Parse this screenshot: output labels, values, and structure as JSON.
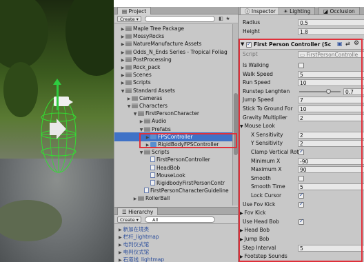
{
  "project": {
    "tab_label": "Project",
    "create_label": "Create",
    "search_placeholder": "",
    "items": [
      {
        "label": "Maple Tree Package",
        "kind": "folder",
        "expanded": false
      },
      {
        "label": "MossyRocks",
        "kind": "folder",
        "expanded": false
      },
      {
        "label": "NatureManufacture Assets",
        "kind": "folder",
        "expanded": false
      },
      {
        "label": "Odds_N_Ends Series - Tropical Foliag",
        "kind": "folder",
        "expanded": false
      },
      {
        "label": "PostProcessing",
        "kind": "folder",
        "expanded": false
      },
      {
        "label": "Rock_pack",
        "kind": "folder",
        "expanded": false
      },
      {
        "label": "Scenes",
        "kind": "folder",
        "expanded": false
      },
      {
        "label": "Scripts",
        "kind": "folder",
        "expanded": false
      },
      {
        "label": "Standard Assets",
        "kind": "folder",
        "expanded": true
      },
      {
        "label": "Cameras",
        "kind": "folder",
        "expanded": false
      },
      {
        "label": "Characters",
        "kind": "folder",
        "expanded": true
      },
      {
        "label": "FirstPersonCharacter",
        "kind": "folder",
        "expanded": true
      },
      {
        "label": "Audio",
        "kind": "folder",
        "expanded": false
      },
      {
        "label": "Prefabs",
        "kind": "folder",
        "expanded": true
      },
      {
        "label": "FPSController",
        "kind": "prefab",
        "expanded": false,
        "selected": true
      },
      {
        "label": "RigidBodyFPSController",
        "kind": "prefab",
        "expanded": false
      },
      {
        "label": "Scripts",
        "kind": "folder",
        "expanded": true
      },
      {
        "label": "FirstPersonController",
        "kind": "file"
      },
      {
        "label": "HeadBob",
        "kind": "file"
      },
      {
        "label": "MouseLook",
        "kind": "file"
      },
      {
        "label": "RigidbodyFirstPersonContr",
        "kind": "file"
      },
      {
        "label": "FirstPersonCharacterGuideline",
        "kind": "file"
      },
      {
        "label": "RollerBall",
        "kind": "folder",
        "expanded": false
      }
    ]
  },
  "hierarchy": {
    "tab_label": "Hierarchy",
    "create_label": "Create",
    "search_placeholder": "All",
    "items": [
      "新加在境类",
      "栏杆_lightmap",
      "电判仪式馆",
      "电判仪式馆",
      "石道线_lightmap"
    ]
  },
  "inspector": {
    "tabs": [
      "Inspector",
      "Lighting",
      "Occlusion"
    ],
    "top_fields": [
      {
        "label": "Radius",
        "value": "0.5"
      },
      {
        "label": "Height",
        "value": "1.8"
      }
    ],
    "component_title": "First Person Controller (Sc",
    "script_label": "Script",
    "script_value": "FirstPersonControlle",
    "fields": [
      {
        "label": "Is Walking",
        "type": "checkbox",
        "checked": false
      },
      {
        "label": "Walk Speed",
        "type": "text",
        "value": "5"
      },
      {
        "label": "Run Speed",
        "type": "text",
        "value": "10"
      },
      {
        "label": "Runstep Lenghten",
        "type": "slider",
        "value": "0.7"
      },
      {
        "label": "Jump Speed",
        "type": "text",
        "value": "7"
      },
      {
        "label": "Stick To Ground For",
        "type": "text",
        "value": "10"
      },
      {
        "label": "Gravity Multiplier",
        "type": "text",
        "value": "2"
      },
      {
        "label": "Mouse Look",
        "type": "foldout"
      },
      {
        "label": "X Sensitivity",
        "type": "text",
        "value": "2",
        "indent": true
      },
      {
        "label": "Y Sensitivity",
        "type": "text",
        "value": "2",
        "indent": true
      },
      {
        "label": "Clamp Vertical Rot",
        "type": "checkbox",
        "checked": true,
        "indent": true
      },
      {
        "label": "Minimum X",
        "type": "text",
        "value": "-90",
        "indent": true
      },
      {
        "label": "Maximum X",
        "type": "text",
        "value": "90",
        "indent": true
      },
      {
        "label": "Smooth",
        "type": "checkbox",
        "checked": false,
        "indent": true
      },
      {
        "label": "Smooth Time",
        "type": "text",
        "value": "5",
        "indent": true
      },
      {
        "label": "Lock Cursor",
        "type": "checkbox",
        "checked": true,
        "indent": true
      },
      {
        "label": "Use Fov Kick",
        "type": "checkbox",
        "checked": true
      },
      {
        "label": "Fov Kick",
        "type": "foldout-closed"
      },
      {
        "label": "Use Head Bob",
        "type": "checkbox",
        "checked": true
      },
      {
        "label": "Head Bob",
        "type": "foldout-closed"
      },
      {
        "label": "Jump Bob",
        "type": "foldout-closed"
      },
      {
        "label": "Step Interval",
        "type": "text",
        "value": "5"
      },
      {
        "label": "Footstep Sounds",
        "type": "foldout-closed"
      }
    ]
  },
  "colors": {
    "selection": "#3f72c7",
    "highlight_box": "#e0303a",
    "panel": "#c8c8c8"
  }
}
